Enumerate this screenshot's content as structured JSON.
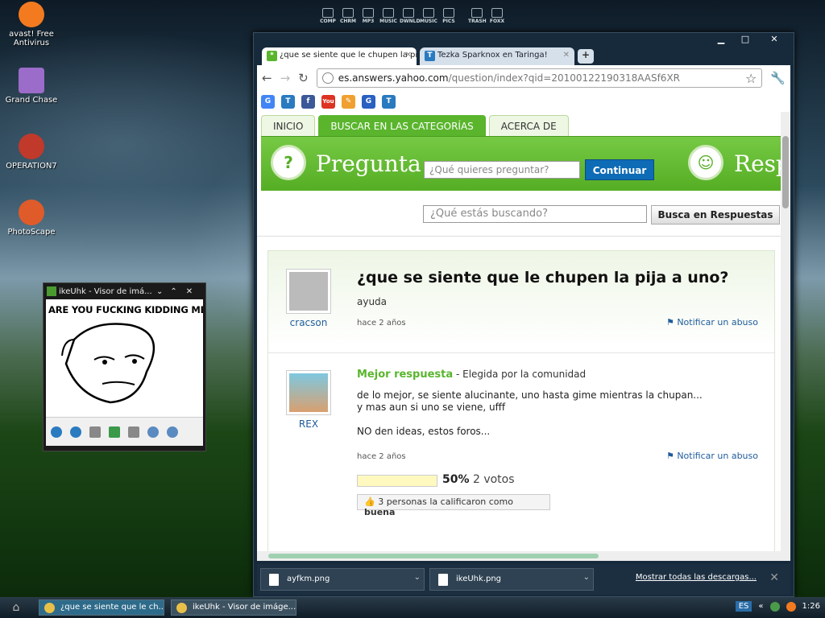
{
  "desktop": {
    "icons": [
      {
        "label_lines": [
          "avast! Free",
          "Antivirus"
        ],
        "color": "#f47a20"
      },
      {
        "label_lines": [
          "Grand Chase"
        ],
        "color": "#9b6cc9"
      },
      {
        "label_lines": [
          "OPERATION7"
        ],
        "color": "#c0392b"
      },
      {
        "label_lines": [
          "PhotoScape"
        ],
        "color": "#e05b2a"
      }
    ],
    "rocket": [
      "COMP",
      "CHRM",
      "MP3",
      "MUSIC",
      "DWNLD",
      "MUSIC",
      "PICS",
      "TRASH",
      "FOXX"
    ]
  },
  "viewer": {
    "title": "ikeUhk - Visor de imá...",
    "meme_text": "ARE YOU FUCKING KIDDING ME"
  },
  "chrome": {
    "tabs": [
      {
        "label": "¿que se siente que le chupen la pij",
        "icon": "*",
        "color": "#5ab52d"
      },
      {
        "label": "Tezka Sparknox en Taringa!",
        "icon": "T",
        "color": "#2a7ac0"
      }
    ],
    "url": {
      "host": "es.answers.yahoo.com",
      "path": "/question/index?qid=20100122190318AASf6XR"
    },
    "bookmarks": [
      {
        "t": "G",
        "c": "#4285f4"
      },
      {
        "t": "T",
        "c": "#2a7ac0"
      },
      {
        "t": "f",
        "c": "#3b5998"
      },
      {
        "t": "You",
        "c": "#d32"
      },
      {
        "t": "✎",
        "c": "#f0a030"
      },
      {
        "t": "G",
        "c": "#2a60c0"
      },
      {
        "t": "T",
        "c": "#2a7ac0"
      }
    ],
    "downloads": [
      "ayfkm.png",
      "ikeUhk.png"
    ],
    "show_all": "Mostrar todas las descargas..."
  },
  "page": {
    "tabs": [
      "INICIO",
      "BUSCAR EN LAS CATEGORÍAS",
      "ACERCA DE"
    ],
    "pregunta": "Pregunta",
    "question_placeholder": "¿Qué quieres preguntar?",
    "continue": "Continuar",
    "respuestas": "Resp",
    "search_placeholder": "¿Qué estás buscando?",
    "search_button": "Busca en Respuestas",
    "question": {
      "title": "¿que se siente que le chupen la pija a uno?",
      "desc": "ayuda",
      "user": "cracson",
      "time": "hace 2 años",
      "abuse": "Notificar un abuso"
    },
    "answer": {
      "label": "Mejor respuesta",
      "chosen": " - Elegida por la comunidad",
      "lines": [
        "de lo mejor, se siente alucinante, uno hasta gime mientras la chupan...",
        "y mas aun si uno se viene, ufff",
        "",
        "NO den ideas, estos foros..."
      ],
      "user": "REX",
      "time": "hace 2 años",
      "abuse": "Notificar un abuso",
      "percent": "50%",
      "votes": "2 votos",
      "rating_prefix": "3 personas la calificaron como ",
      "rating_word": "buena"
    }
  },
  "taskbar": {
    "tasks": [
      "¿que se siente que le ch...",
      "ikeUhk - Visor de imáge..."
    ],
    "lang": "ES",
    "clock": "1:26"
  }
}
